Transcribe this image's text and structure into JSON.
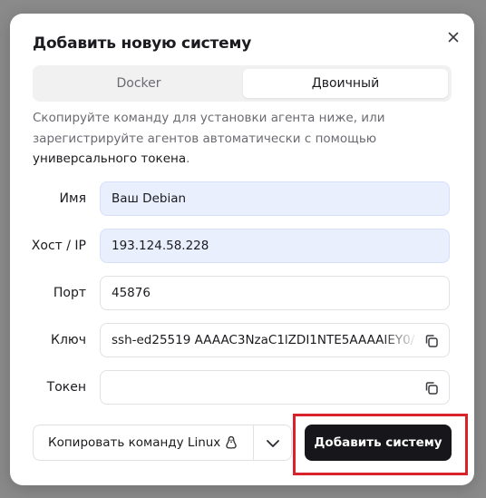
{
  "dialog": {
    "title": "Добавить новую систему",
    "close_icon": "close-icon"
  },
  "tabs": [
    {
      "label": "Docker",
      "active": false
    },
    {
      "label": "Двоичный",
      "active": true
    }
  ],
  "description": {
    "text_before": "Скопируйте команду для установки агента ниже, или зарегистрируйте агентов автоматически с помощью ",
    "link_text": "универсального токена",
    "text_after": "."
  },
  "form": {
    "name": {
      "label": "Имя",
      "value": "Ваш Debian"
    },
    "host": {
      "label": "Хост / IP",
      "value": "193.124.58.228"
    },
    "port": {
      "label": "Порт",
      "value": "45876"
    },
    "key": {
      "label": "Ключ",
      "value": "ssh-ed25519 AAAAC3NzaC1lZDI1NTE5AAAAIEY0/"
    },
    "token": {
      "label": "Токен",
      "value": ""
    }
  },
  "actions": {
    "copy_command_label": "Копировать команду Linux",
    "copy_command_icon": "linux-icon",
    "dropdown_icon": "chevron-down-icon",
    "add_label": "Добавить систему"
  },
  "colors": {
    "primary_button": "#17171b",
    "filled_field": "#e9effd",
    "highlight": "#d9232a"
  }
}
